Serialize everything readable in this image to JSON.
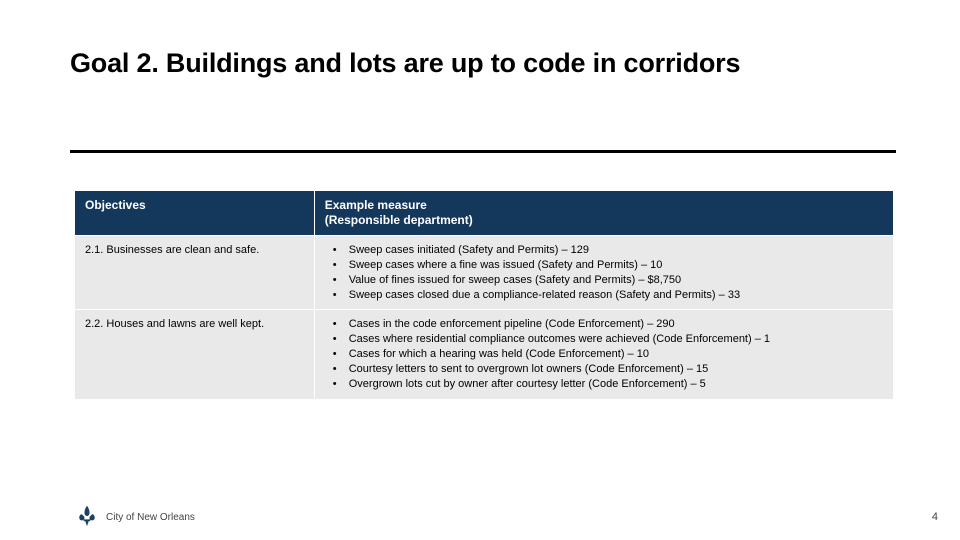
{
  "title": "Goal 2. Buildings and lots are up to code in corridors",
  "columns": {
    "objectives": "Objectives",
    "measures": "Example measure\n(Responsible department)"
  },
  "rows": [
    {
      "objective": "2.1. Businesses are clean and safe.",
      "measures": [
        "Sweep cases initiated (Safety and Permits) – 129",
        "Sweep cases where a fine was issued (Safety and Permits) – 10",
        "Value of fines issued for sweep cases (Safety and Permits) – $8,750",
        "Sweep cases closed due a compliance-related reason (Safety and Permits) – 33"
      ]
    },
    {
      "objective": "2.2. Houses and lawns are well kept.",
      "measures": [
        "Cases in the code enforcement pipeline (Code Enforcement) – 290",
        "Cases where residential compliance outcomes were achieved (Code Enforcement) – 1",
        "Cases for which a hearing was held (Code Enforcement) – 10",
        "Courtesy letters to sent to overgrown lot owners (Code Enforcement) – 15",
        "Overgrown lots cut by owner after courtesy letter (Code Enforcement) – 5"
      ]
    }
  ],
  "footer": {
    "org": "City of New Orleans",
    "page": "4"
  },
  "colors": {
    "header_bg": "#14375c",
    "row_bg": "#e9e9e9",
    "logo": "#1e3f66"
  }
}
